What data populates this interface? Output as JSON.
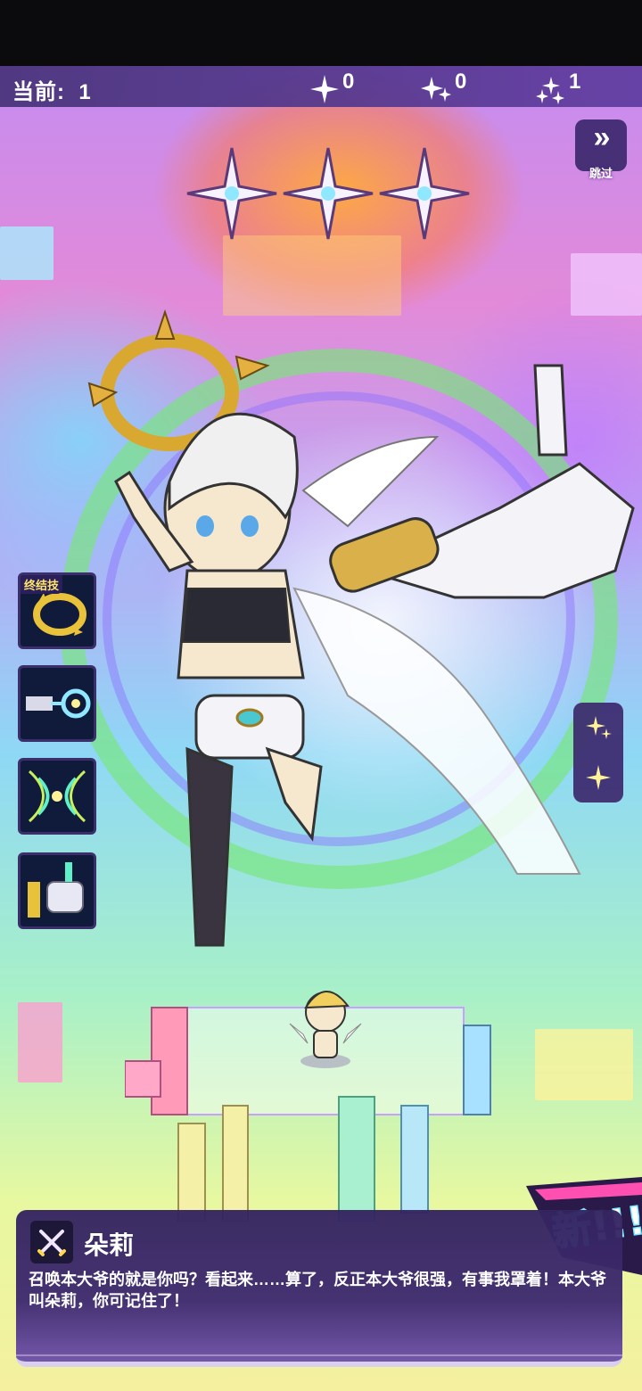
{
  "top_bar": {
    "current_label": "当前:",
    "current_value": "1",
    "counters": [
      {
        "icon": "sparkle-1-icon",
        "value": "0"
      },
      {
        "icon": "sparkle-2-icon",
        "value": "0"
      },
      {
        "icon": "sparkle-3-icon",
        "value": "1"
      }
    ]
  },
  "skip": {
    "label": "跳过"
  },
  "rarity": {
    "stars": 3
  },
  "skills": [
    {
      "icon": "halo-skill-icon",
      "tag": "终结技"
    },
    {
      "icon": "beam-skill-icon",
      "tag": ""
    },
    {
      "icon": "wave-skill-icon",
      "tag": ""
    },
    {
      "icon": "fist-skill-icon",
      "tag": ""
    }
  ],
  "side_buttons": [
    {
      "icon": "double-sparkle-icon"
    },
    {
      "icon": "single-sparkle-icon"
    }
  ],
  "badge": {
    "text": "新!!!"
  },
  "dialog": {
    "class_icon": "crossed-swords-icon",
    "name": "朵莉",
    "text": "召唤本大爷的就是你吗？看起来……算了，反正本大爷很强，有事我罩着！本大爷叫朵莉，你可记住了！"
  }
}
